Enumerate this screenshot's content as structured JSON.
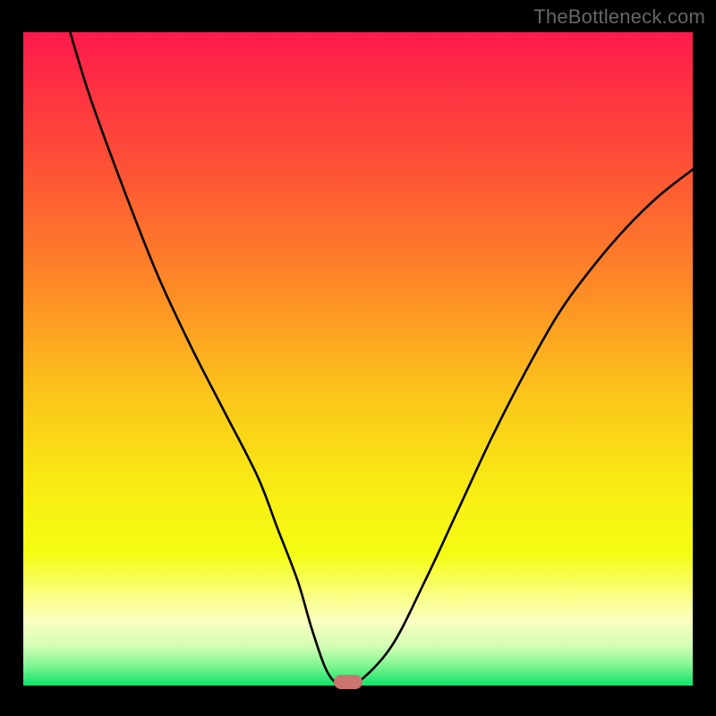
{
  "watermark": {
    "text": "TheBottleneck.com"
  },
  "chart_data": {
    "type": "line",
    "title": "",
    "xlabel": "",
    "ylabel": "",
    "xlim": [
      0,
      100
    ],
    "ylim": [
      0,
      100
    ],
    "grid": false,
    "legend": false,
    "series": [
      {
        "name": "curve",
        "x": [
          7,
          10,
          15,
          20,
          25,
          30,
          35,
          38,
          41,
          43,
          45,
          46.5,
          48,
          50,
          55,
          60,
          65,
          70,
          75,
          80,
          85,
          90,
          95,
          100
        ],
        "y": [
          100,
          90,
          76,
          63,
          52,
          42,
          32,
          24,
          16,
          9,
          3,
          0.6,
          0.5,
          0.5,
          6,
          16,
          27,
          38,
          48,
          57,
          64,
          70,
          75,
          79
        ]
      }
    ],
    "marker": {
      "x": 48.5,
      "y": 0.5,
      "shape": "rounded-rect",
      "color": "#cb7470"
    },
    "background_gradient": {
      "direction": "vertical",
      "stops": [
        {
          "pos": 0.0,
          "color": "#fd1a4b"
        },
        {
          "pos": 0.2,
          "color": "#fe5036"
        },
        {
          "pos": 0.4,
          "color": "#fd8d25"
        },
        {
          "pos": 0.55,
          "color": "#fbc41a"
        },
        {
          "pos": 0.7,
          "color": "#f8ed13"
        },
        {
          "pos": 0.8,
          "color": "#f4fd13"
        },
        {
          "pos": 0.86,
          "color": "#f9ff7f"
        },
        {
          "pos": 0.9,
          "color": "#fbffc1"
        },
        {
          "pos": 0.94,
          "color": "#d3fdb4"
        },
        {
          "pos": 0.97,
          "color": "#7ef590"
        },
        {
          "pos": 1.0,
          "color": "#0de36a"
        }
      ]
    }
  }
}
